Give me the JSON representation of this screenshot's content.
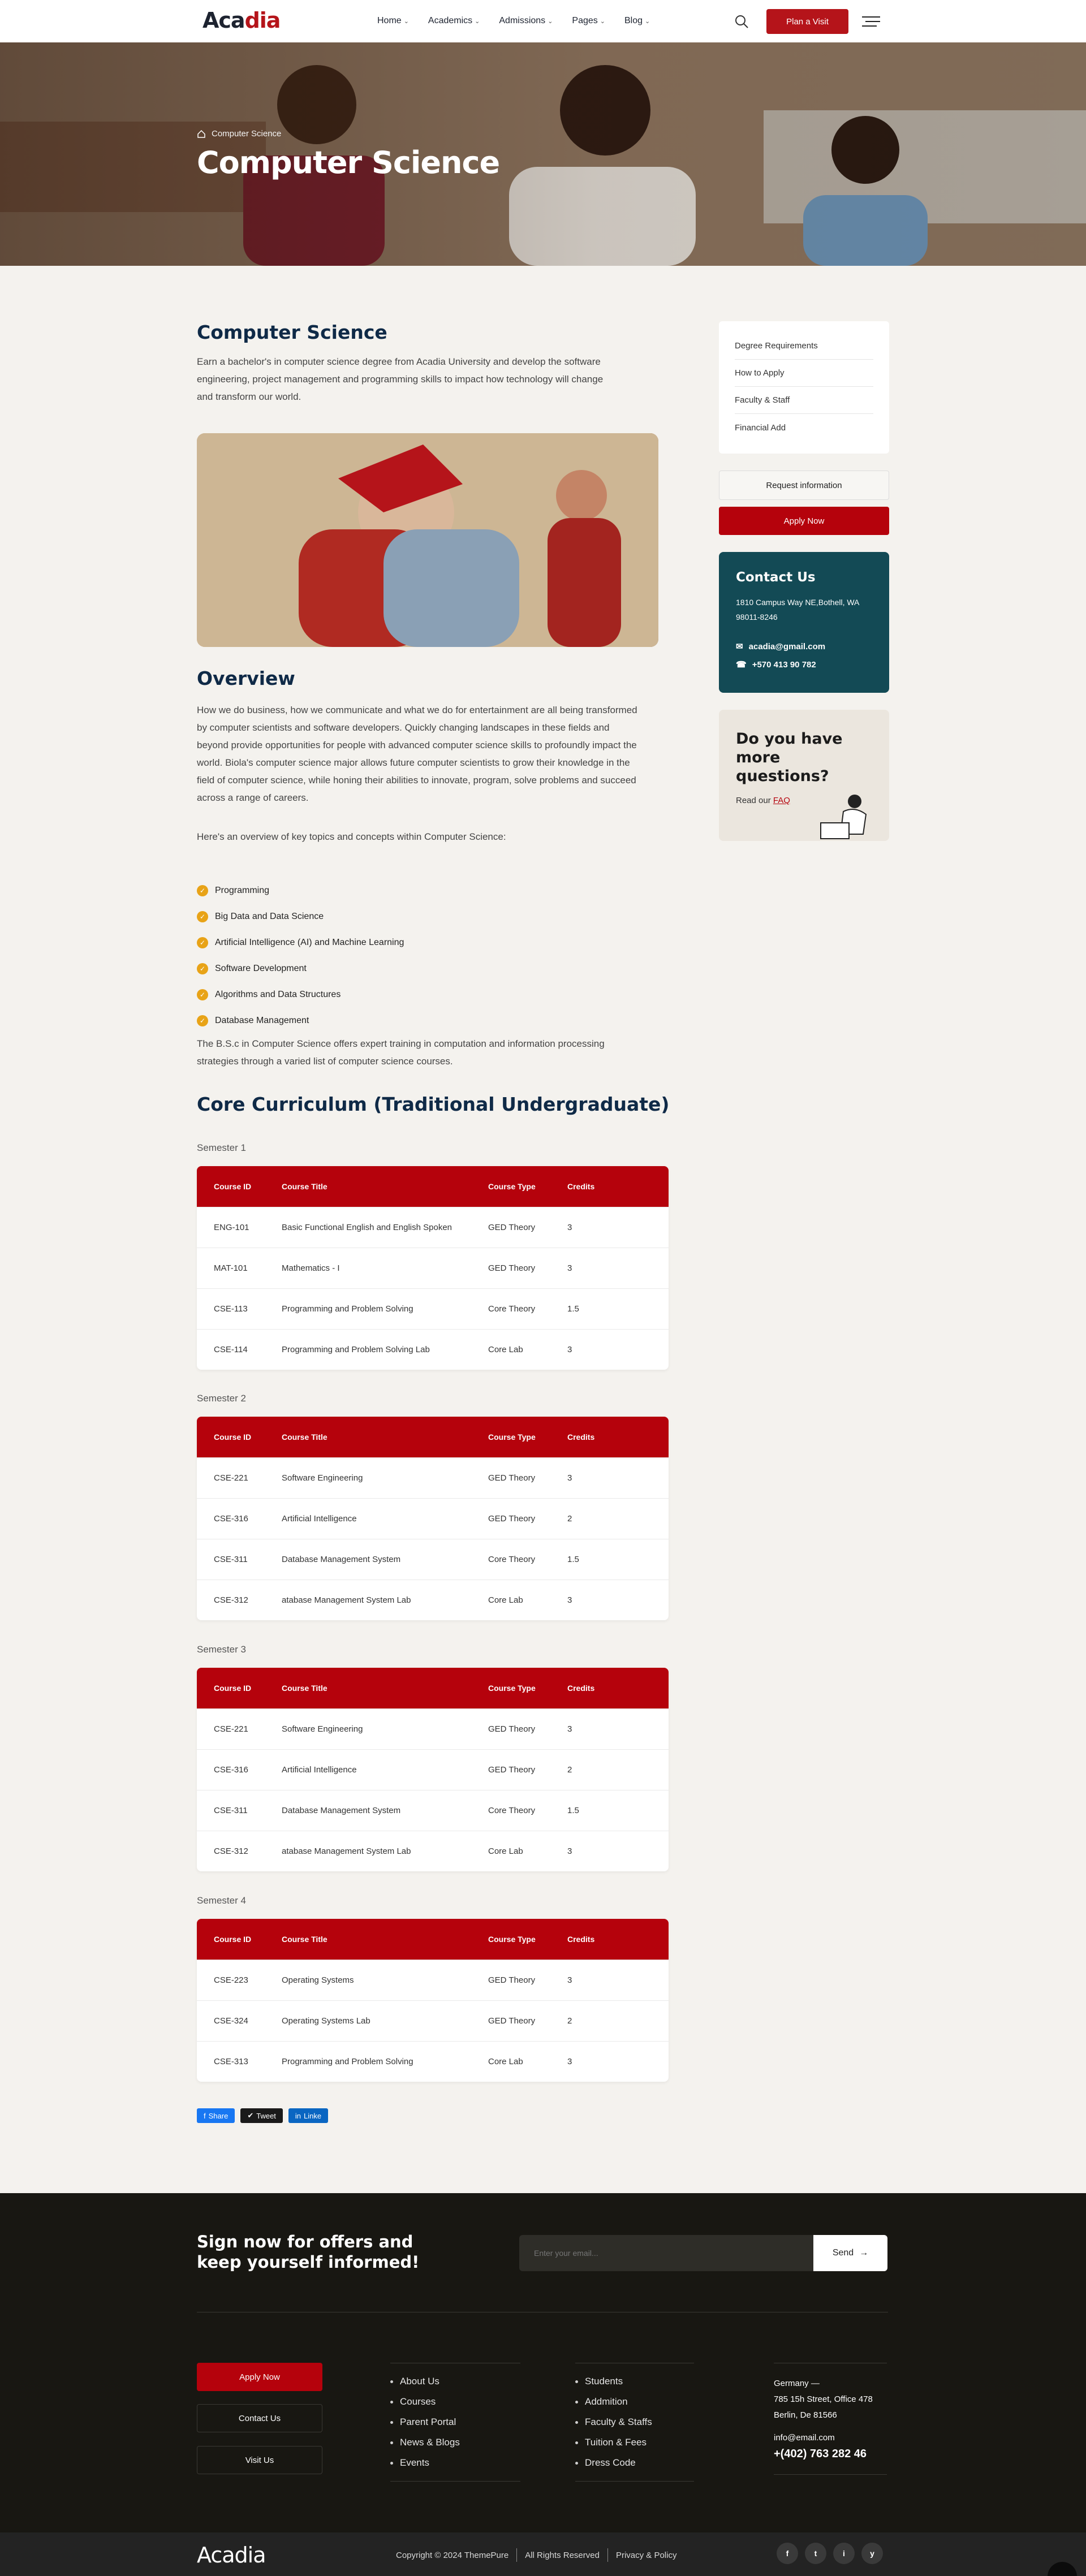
{
  "header": {
    "logo_pre": "Aca",
    "logo_post": "dia",
    "nav": [
      "Home",
      "Academics",
      "Admissions",
      "Pages",
      "Blog"
    ],
    "cta": "Plan a Visit"
  },
  "hero": {
    "breadcrumb": "Computer Science",
    "title": "Computer Science"
  },
  "intro": {
    "title": "Computer Science",
    "text": "Earn a bachelor's in computer science degree from Acadia University and develop the software engineering, project management and programming skills to impact how technology will change and transform our world."
  },
  "overview": {
    "title": "Overview",
    "text": "How we do business, how we communicate and what we do for entertainment are all being transformed by computer scientists and software developers. Quickly changing landscapes in these fields and beyond provide opportunities for people with advanced computer science skills to profoundly impact the world. Biola's computer science major allows future computer scientists to grow their knowledge in the field of computer science, while honing their abilities to innovate, program, solve problems and succeed across a range of careers.",
    "topics_intro": "Here's an overview of key topics and concepts within Computer Science:",
    "topics": [
      "Programming",
      "Big Data and Data Science",
      "Artificial Intelligence (AI) and Machine Learning",
      "Software Development",
      "Algorithms and Data Structures",
      "Database Management"
    ],
    "bsc": "The B.S.c in Computer Science offers expert training in computation and information processing strategies through a varied list of computer science courses."
  },
  "curriculum": {
    "title": "Core Curriculum (Traditional Undergraduate)",
    "headers": [
      "Course ID",
      "Course Title",
      "Course Type",
      "Credits"
    ],
    "semesters": [
      {
        "label": "Semester 1",
        "rows": [
          [
            "ENG-101",
            "Basic Functional English and English Spoken",
            "GED Theory",
            "3"
          ],
          [
            "MAT-101",
            "Mathematics - I",
            "GED Theory",
            "3"
          ],
          [
            "CSE-113",
            "Programming and Problem Solving",
            "Core Theory",
            "1.5"
          ],
          [
            "CSE-114",
            "Programming and Problem Solving Lab",
            "Core Lab",
            "3"
          ]
        ]
      },
      {
        "label": "Semester 2",
        "rows": [
          [
            "CSE-221",
            "Software Engineering",
            "GED Theory",
            "3"
          ],
          [
            "CSE-316",
            "Artificial Intelligence",
            "GED Theory",
            "2"
          ],
          [
            "CSE-311",
            "Database Management System",
            "Core Theory",
            "1.5"
          ],
          [
            "CSE-312",
            "atabase Management System Lab",
            "Core Lab",
            "3"
          ]
        ]
      },
      {
        "label": "Semester 3",
        "rows": [
          [
            "CSE-221",
            "Software Engineering",
            "GED Theory",
            "3"
          ],
          [
            "CSE-316",
            "Artificial Intelligence",
            "GED Theory",
            "2"
          ],
          [
            "CSE-311",
            "Database Management System",
            "Core Theory",
            "1.5"
          ],
          [
            "CSE-312",
            "atabase Management System Lab",
            "Core Lab",
            "3"
          ]
        ]
      },
      {
        "label": "Semester 4",
        "rows": [
          [
            "CSE-223",
            "Operating Systems",
            "GED Theory",
            "3"
          ],
          [
            "CSE-324",
            "Operating Systems Lab",
            "GED Theory",
            "2"
          ],
          [
            "CSE-313",
            "Programming and Problem Solving",
            "Core Lab",
            "3"
          ]
        ]
      }
    ]
  },
  "share": {
    "facebook": "Share",
    "twitter": "Tweet",
    "linkedin": "Linke",
    "colors": [
      "#1877f2",
      "#1a1a1a",
      "#0a66c2"
    ]
  },
  "sidebar": {
    "links": [
      "Degree Requirements",
      "How to Apply",
      "Faculty & Staff",
      "Financial Add"
    ],
    "request": "Request information",
    "apply": "Apply Now",
    "contact": {
      "title": "Contact Us",
      "address": "1810 Campus Way NE,Bothell, WA 98011-8246",
      "email": "acadia@gmail.com",
      "phone": "+570 413 90 782"
    },
    "faq": {
      "title": "Do you have more questions?",
      "text": "Read our",
      "link": "FAQ"
    }
  },
  "newsletter": {
    "title": "Sign now for offers and keep yourself informed!",
    "placeholder": "Enter your email...",
    "send": "Send"
  },
  "footer": {
    "buttons": [
      "Apply Now",
      "Contact Us",
      "Visit Us"
    ],
    "col1": [
      "About Us",
      "Courses",
      "Parent Portal",
      "News & Blogs",
      "Events"
    ],
    "col2": [
      "Students",
      "Addmition",
      "Faculty & Staffs",
      "Tuition & Fees",
      "Dress Code"
    ],
    "address": {
      "line1": "Germany —",
      "line2": "785 15h Street, Office 478",
      "line3": "Berlin, De 81566",
      "email": "info@email.com",
      "phone": "+(402) 763 282 46"
    },
    "copyright": "Copyright © 2024 ThemePure",
    "rights": "All Rights Reserved",
    "privacy": "Privacy & Policy",
    "social": [
      "f",
      "t",
      "i",
      "y"
    ]
  },
  "colors": {
    "brand": "#b5020c",
    "navy": "#0f2a47",
    "teal": "#134a55"
  }
}
